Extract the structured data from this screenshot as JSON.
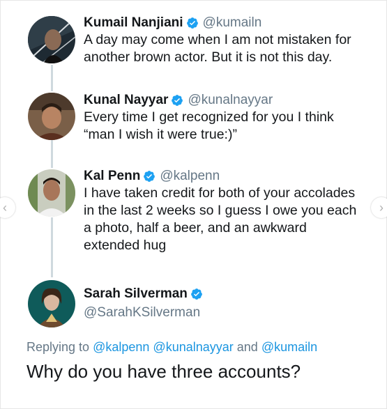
{
  "tweets": [
    {
      "name": "Kumail Nanjiani",
      "handle": "@kumailn",
      "lines": [
        "A day may come when I am not mistaken for",
        "another brown actor. But it is not this day."
      ]
    },
    {
      "name": "Kunal Nayyar",
      "handle": "@kunalnayyar",
      "lines": [
        "Every time I get recognized for you I think",
        "“man I wish it were true:)”"
      ]
    },
    {
      "name": "Kal Penn",
      "handle": "@kalpenn",
      "lines": [
        "I have taken credit for both of your accolades",
        "in the last 2 weeks so I guess I owe you each",
        "a photo, half a beer, and an awkward",
        "extended hug"
      ]
    }
  ],
  "reply": {
    "name": "Sarah Silverman",
    "handle": "@SarahKSilverman",
    "replying_prefix": "Replying to",
    "mentions": [
      "@kalpenn",
      "@kunalnayyar",
      "@kumailn"
    ],
    "conjunction": "and",
    "text": "Why do you have three accounts?"
  },
  "icons": {
    "verified": "verified-badge-icon",
    "prev": "chevron-left-icon",
    "next": "chevron-right-icon"
  },
  "colors": {
    "verified": "#1da1f2",
    "link": "#1b95e0",
    "muted": "#657786",
    "thread_line": "#cfd9de"
  }
}
